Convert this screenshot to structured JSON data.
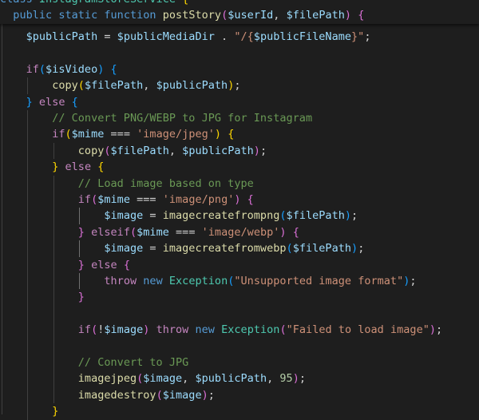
{
  "editor": {
    "language": "php",
    "theme": "dark",
    "sticky_lines": [
      [
        {
          "t": "class ",
          "c": "kw"
        },
        {
          "t": "InstagramStoreService",
          "c": "cls"
        },
        {
          "t": " {",
          "c": "b1"
        }
      ],
      [
        {
          "t": "  "
        },
        {
          "t": "public",
          "c": "kw"
        },
        {
          "t": " "
        },
        {
          "t": "static",
          "c": "kw"
        },
        {
          "t": " "
        },
        {
          "t": "function",
          "c": "kw"
        },
        {
          "t": " "
        },
        {
          "t": "postStory",
          "c": "fn"
        },
        {
          "t": "(",
          "c": "b2"
        },
        {
          "t": "$userId",
          "c": "var"
        },
        {
          "t": ", "
        },
        {
          "t": "$filePath",
          "c": "var"
        },
        {
          "t": ")",
          "c": "b2"
        },
        {
          "t": " "
        },
        {
          "t": "{",
          "c": "b2"
        }
      ]
    ],
    "lines": [
      [
        {
          "t": "    "
        },
        {
          "t": "$publicPath",
          "c": "var"
        },
        {
          "t": " = "
        },
        {
          "t": "$publicMediaDir",
          "c": "var"
        },
        {
          "t": " . "
        },
        {
          "t": "\"/{",
          "c": "str"
        },
        {
          "t": "$publicFileName",
          "c": "var"
        },
        {
          "t": "}\"",
          "c": "str"
        },
        {
          "t": ";"
        }
      ],
      [],
      [
        {
          "t": "    "
        },
        {
          "t": "if",
          "c": "ctl"
        },
        {
          "t": "(",
          "c": "b3"
        },
        {
          "t": "$isVideo",
          "c": "var"
        },
        {
          "t": ")",
          "c": "b3"
        },
        {
          "t": " "
        },
        {
          "t": "{",
          "c": "b3"
        }
      ],
      [
        {
          "t": "        "
        },
        {
          "t": "copy",
          "c": "fn"
        },
        {
          "t": "(",
          "c": "b1"
        },
        {
          "t": "$filePath",
          "c": "var"
        },
        {
          "t": ", "
        },
        {
          "t": "$publicPath",
          "c": "var"
        },
        {
          "t": ")",
          "c": "b1"
        },
        {
          "t": ";"
        }
      ],
      [
        {
          "t": "    "
        },
        {
          "t": "}",
          "c": "b3"
        },
        {
          "t": " "
        },
        {
          "t": "else",
          "c": "ctl"
        },
        {
          "t": " "
        },
        {
          "t": "{",
          "c": "b3"
        }
      ],
      [
        {
          "t": "        "
        },
        {
          "t": "// Convert PNG/WEBP to JPG for Instagram",
          "c": "cmt"
        }
      ],
      [
        {
          "t": "        "
        },
        {
          "t": "if",
          "c": "ctl"
        },
        {
          "t": "(",
          "c": "b1"
        },
        {
          "t": "$mime",
          "c": "var"
        },
        {
          "t": " === "
        },
        {
          "t": "'image/jpeg'",
          "c": "str"
        },
        {
          "t": ")",
          "c": "b1"
        },
        {
          "t": " "
        },
        {
          "t": "{",
          "c": "b1"
        }
      ],
      [
        {
          "t": "            "
        },
        {
          "t": "copy",
          "c": "fn"
        },
        {
          "t": "(",
          "c": "b2"
        },
        {
          "t": "$filePath",
          "c": "var"
        },
        {
          "t": ", "
        },
        {
          "t": "$publicPath",
          "c": "var"
        },
        {
          "t": ")",
          "c": "b2"
        },
        {
          "t": ";"
        }
      ],
      [
        {
          "t": "        "
        },
        {
          "t": "}",
          "c": "b1"
        },
        {
          "t": " "
        },
        {
          "t": "else",
          "c": "ctl"
        },
        {
          "t": " "
        },
        {
          "t": "{",
          "c": "b1"
        }
      ],
      [
        {
          "t": "            "
        },
        {
          "t": "// Load image based on type",
          "c": "cmt"
        }
      ],
      [
        {
          "t": "            "
        },
        {
          "t": "if",
          "c": "ctl"
        },
        {
          "t": "(",
          "c": "b2"
        },
        {
          "t": "$mime",
          "c": "var"
        },
        {
          "t": " === "
        },
        {
          "t": "'image/png'",
          "c": "str"
        },
        {
          "t": ")",
          "c": "b2"
        },
        {
          "t": " "
        },
        {
          "t": "{",
          "c": "b2"
        }
      ],
      [
        {
          "t": "                "
        },
        {
          "t": "$image",
          "c": "var"
        },
        {
          "t": " = "
        },
        {
          "t": "imagecreatefrompng",
          "c": "fn"
        },
        {
          "t": "(",
          "c": "b3"
        },
        {
          "t": "$filePath",
          "c": "var"
        },
        {
          "t": ")",
          "c": "b3"
        },
        {
          "t": ";"
        }
      ],
      [
        {
          "t": "            "
        },
        {
          "t": "}",
          "c": "b2"
        },
        {
          "t": " "
        },
        {
          "t": "elseif",
          "c": "ctl"
        },
        {
          "t": "(",
          "c": "b2"
        },
        {
          "t": "$mime",
          "c": "var"
        },
        {
          "t": " === "
        },
        {
          "t": "'image/webp'",
          "c": "str"
        },
        {
          "t": ")",
          "c": "b2"
        },
        {
          "t": " "
        },
        {
          "t": "{",
          "c": "b2"
        }
      ],
      [
        {
          "t": "                "
        },
        {
          "t": "$image",
          "c": "var"
        },
        {
          "t": " = "
        },
        {
          "t": "imagecreatefromwebp",
          "c": "fn"
        },
        {
          "t": "(",
          "c": "b3"
        },
        {
          "t": "$filePath",
          "c": "var"
        },
        {
          "t": ")",
          "c": "b3"
        },
        {
          "t": ";"
        }
      ],
      [
        {
          "t": "            "
        },
        {
          "t": "}",
          "c": "b2"
        },
        {
          "t": " "
        },
        {
          "t": "else",
          "c": "ctl"
        },
        {
          "t": " "
        },
        {
          "t": "{",
          "c": "b2"
        }
      ],
      [
        {
          "t": "                "
        },
        {
          "t": "throw",
          "c": "ctl"
        },
        {
          "t": " "
        },
        {
          "t": "new",
          "c": "kw"
        },
        {
          "t": " "
        },
        {
          "t": "Exception",
          "c": "cls"
        },
        {
          "t": "(",
          "c": "b3"
        },
        {
          "t": "\"Unsupported image format\"",
          "c": "str"
        },
        {
          "t": ")",
          "c": "b3"
        },
        {
          "t": ";"
        }
      ],
      [
        {
          "t": "            "
        },
        {
          "t": "}",
          "c": "b2"
        }
      ],
      [],
      [
        {
          "t": "            "
        },
        {
          "t": "if",
          "c": "ctl"
        },
        {
          "t": "(",
          "c": "b2"
        },
        {
          "t": "!"
        },
        {
          "t": "$image",
          "c": "var"
        },
        {
          "t": ")",
          "c": "b2"
        },
        {
          "t": " "
        },
        {
          "t": "throw",
          "c": "ctl"
        },
        {
          "t": " "
        },
        {
          "t": "new",
          "c": "kw"
        },
        {
          "t": " "
        },
        {
          "t": "Exception",
          "c": "cls"
        },
        {
          "t": "(",
          "c": "b2"
        },
        {
          "t": "\"Failed to load image\"",
          "c": "str"
        },
        {
          "t": ")",
          "c": "b2"
        },
        {
          "t": ";"
        }
      ],
      [],
      [
        {
          "t": "            "
        },
        {
          "t": "// Convert to JPG",
          "c": "cmt"
        }
      ],
      [
        {
          "t": "            "
        },
        {
          "t": "imagejpeg",
          "c": "fn"
        },
        {
          "t": "(",
          "c": "b2"
        },
        {
          "t": "$image",
          "c": "var"
        },
        {
          "t": ", "
        },
        {
          "t": "$publicPath",
          "c": "var"
        },
        {
          "t": ", "
        },
        {
          "t": "95",
          "c": "num"
        },
        {
          "t": ")",
          "c": "b2"
        },
        {
          "t": ";"
        }
      ],
      [
        {
          "t": "            "
        },
        {
          "t": "imagedestroy",
          "c": "fn"
        },
        {
          "t": "(",
          "c": "b2"
        },
        {
          "t": "$image",
          "c": "var"
        },
        {
          "t": ")",
          "c": "b2"
        },
        {
          "t": ";"
        }
      ],
      [
        {
          "t": "        "
        },
        {
          "t": "}",
          "c": "b1"
        }
      ]
    ]
  }
}
